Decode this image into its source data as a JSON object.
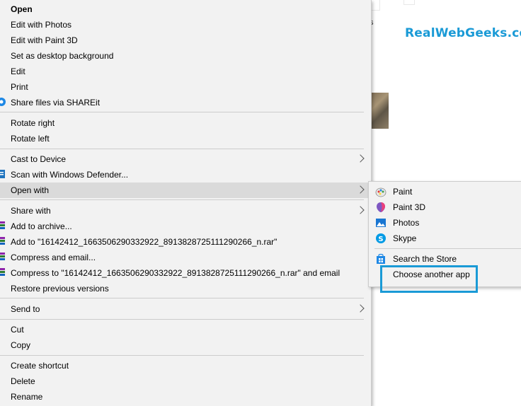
{
  "background": {
    "fragment_text": "s",
    "watermark": "RealWebGeeks.com",
    "accent_color": "#1a9ad6"
  },
  "menu": {
    "items": [
      {
        "label": "Open",
        "bold": true
      },
      {
        "label": "Edit with Photos"
      },
      {
        "label": "Edit with Paint 3D"
      },
      {
        "label": "Set as desktop background"
      },
      {
        "label": "Edit"
      },
      {
        "label": "Print"
      },
      {
        "label": "Share files via SHAREit",
        "icon": "shareit-icon"
      },
      {
        "label": "Rotate right"
      },
      {
        "label": "Rotate left"
      },
      {
        "label": "Cast to Device",
        "submenu": true
      },
      {
        "label": "Scan with Windows Defender...",
        "icon": "windows-defender-icon"
      },
      {
        "label": "Open with",
        "submenu": true,
        "highlighted": true
      },
      {
        "label": "Share with",
        "submenu": true
      },
      {
        "label": "Add to archive...",
        "icon": "winrar-icon"
      },
      {
        "label": "Add to \"16142412_1663506290332922_8913828725111290266_n.rar\"",
        "icon": "winrar-icon"
      },
      {
        "label": "Compress and email...",
        "icon": "winrar-icon"
      },
      {
        "label": "Compress to \"16142412_1663506290332922_8913828725111290266_n.rar\" and email",
        "icon": "winrar-icon"
      },
      {
        "label": "Restore previous versions"
      },
      {
        "label": "Send to",
        "submenu": true
      },
      {
        "label": "Cut"
      },
      {
        "label": "Copy"
      },
      {
        "label": "Create shortcut"
      },
      {
        "label": "Delete"
      },
      {
        "label": "Rename"
      }
    ]
  },
  "open_with_submenu": {
    "items": [
      {
        "label": "Paint",
        "icon": "paint-icon"
      },
      {
        "label": "Paint 3D",
        "icon": "paint-3d-icon"
      },
      {
        "label": "Photos",
        "icon": "photos-icon"
      },
      {
        "label": "Skype",
        "icon": "skype-icon"
      },
      {
        "label": "Search the Store",
        "icon": "store-icon"
      },
      {
        "label": "Choose another app"
      }
    ]
  }
}
